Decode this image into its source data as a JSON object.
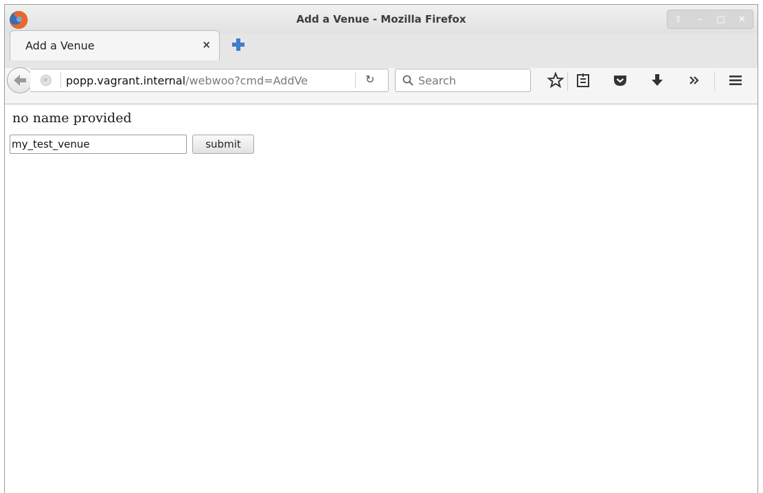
{
  "window": {
    "title": "Add a Venue - Mozilla Firefox"
  },
  "tabs": [
    {
      "label": "Add a Venue",
      "close": "×"
    }
  ],
  "navbar": {
    "url_host": "popp.vagrant.internal",
    "url_path": "/webwoo?cmd=AddVe",
    "search_placeholder": "Search"
  },
  "page": {
    "message": "no name provided",
    "name_value": "my_test_venue",
    "submit_label": "submit"
  },
  "colors": {
    "firefox_orange": "#e8672a",
    "firefox_blue": "#3a6fb0",
    "newtab_blue": "#3f7ec9"
  }
}
